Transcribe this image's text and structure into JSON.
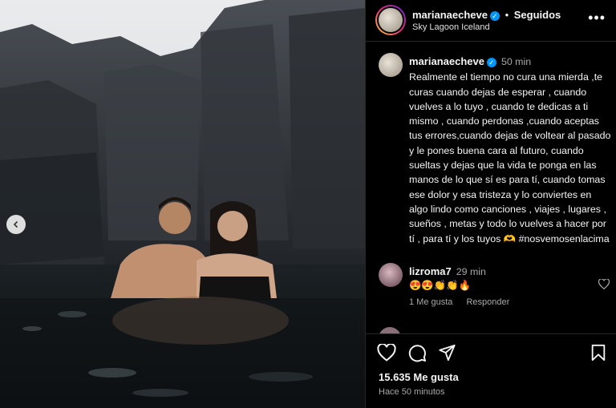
{
  "post": {
    "username": "marianaecheve",
    "follow_state": "Seguidos",
    "separator": "•",
    "location": "Sky Lagoon Iceland",
    "more_icon": "more-horizontal-icon",
    "verified_icon": "verified-badge-icon"
  },
  "caption": {
    "username": "marianaecheve",
    "time": "50 min",
    "text": "Realmente el tiempo no cura una mierda ,te curas cuando dejas de esperar , cuando vuelves a lo tuyo , cuando te dedicas a ti mismo , cuando perdonas ,cuando aceptas tus errores,cuando dejas de voltear al pasado y le pones buena cara al futuro, cuando sueltas y dejas que la vida te ponga en las manos de lo que sí es para tí, cuando tomas ese dolor y esa tristeza y lo conviertes en algo lindo como canciones , viajes , lugares , sueños , metas y todo lo vuelves a hacer por tí , para tí y los tuyos 🫶 #nosvemosenlacima"
  },
  "comment": {
    "username": "lizroma7",
    "time": "29 min",
    "text": "😍😍👏👏🔥",
    "like_label": "1 Me gusta",
    "reply_label": "Responder"
  },
  "actions": {
    "like_icon": "heart-icon",
    "comment_icon": "comment-icon",
    "share_icon": "share-icon",
    "save_icon": "bookmark-icon"
  },
  "stats": {
    "likes": "15.635 Me gusta",
    "posted": "Hace 50 minutos"
  },
  "media": {
    "prev_icon": "chevron-left-icon"
  },
  "colors": {
    "accent": "#0095f6",
    "background": "#000000",
    "muted": "#a8a8a8"
  }
}
